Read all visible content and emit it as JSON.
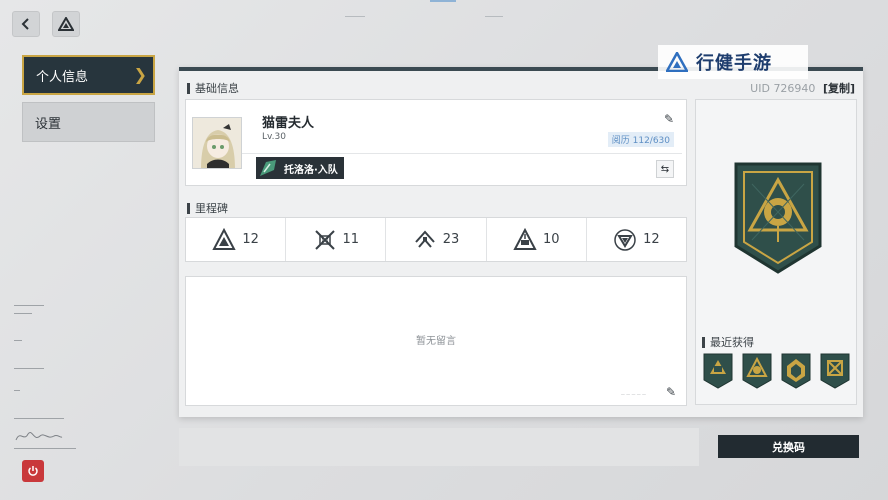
{
  "nav": {
    "back_icon": "chevron-left-icon",
    "drive_icon": "triangle-logo-icon"
  },
  "menu": {
    "profile_label": "个人信息",
    "settings_label": "设置"
  },
  "watermark": {
    "text": "行健手游"
  },
  "basic_info": {
    "title": "基础信息",
    "uid_label": "UID",
    "uid_value": "726940",
    "copy_label": "[复制]"
  },
  "profile": {
    "name": "猫雷夫人",
    "level": "Lv.30",
    "exp": "阅历 112/630",
    "team_label": "托洛洛·入队"
  },
  "milestones": {
    "title": "里程碑",
    "items": [
      {
        "icon": "triangle-mountain-icon",
        "value": "12"
      },
      {
        "icon": "crossed-lines-icon",
        "value": "11"
      },
      {
        "icon": "chevron-stack-icon",
        "value": "23"
      },
      {
        "icon": "pyramid-icon",
        "value": "10"
      },
      {
        "icon": "circle-triangle-icon",
        "value": "12"
      }
    ]
  },
  "message": {
    "empty_text": "暂无留言"
  },
  "recent": {
    "title": "最近获得"
  },
  "redeem": {
    "label": "兑换码"
  },
  "colors": {
    "gold": "#c9a544",
    "dark": "#27353d",
    "badge_teal": "#2f4f4a",
    "power_red": "#c9383b"
  }
}
